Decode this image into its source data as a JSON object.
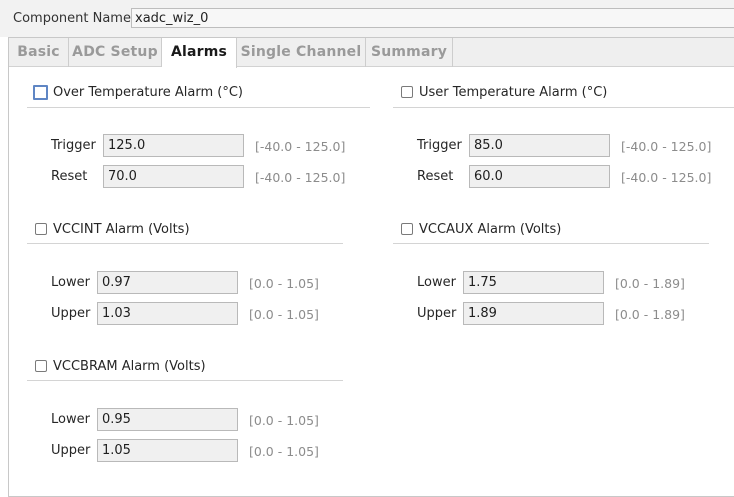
{
  "component": {
    "label": "Component Name",
    "value": "xadc_wiz_0"
  },
  "tabs": [
    {
      "label": "Basic"
    },
    {
      "label": "ADC Setup"
    },
    {
      "label": "Alarms"
    },
    {
      "label": "Single Channel"
    },
    {
      "label": "Summary"
    }
  ],
  "active_tab": "Alarms",
  "alarms": {
    "over_temp": {
      "title": "Over Temperature Alarm (°C)",
      "checked": false,
      "trigger_label": "Trigger",
      "trigger_value": "125.0",
      "trigger_range": "[-40.0 - 125.0]",
      "reset_label": "Reset",
      "reset_value": "70.0",
      "reset_range": "[-40.0 - 125.0]"
    },
    "user_temp": {
      "title": "User Temperature Alarm (°C)",
      "checked": false,
      "trigger_label": "Trigger",
      "trigger_value": "85.0",
      "trigger_range": "[-40.0 - 125.0]",
      "reset_label": "Reset",
      "reset_value": "60.0",
      "reset_range": "[-40.0 - 125.0]"
    },
    "vccint": {
      "title": "VCCINT Alarm (Volts)",
      "checked": false,
      "lower_label": "Lower",
      "lower_value": "0.97",
      "lower_range": "[0.0 - 1.05]",
      "upper_label": "Upper",
      "upper_value": "1.03",
      "upper_range": "[0.0 - 1.05]"
    },
    "vccaux": {
      "title": "VCCAUX Alarm (Volts)",
      "checked": false,
      "lower_label": "Lower",
      "lower_value": "1.75",
      "lower_range": "[0.0 - 1.89]",
      "upper_label": "Upper",
      "upper_value": "1.89",
      "upper_range": "[0.0 - 1.89]"
    },
    "vccbram": {
      "title": "VCCBRAM Alarm (Volts)",
      "checked": false,
      "lower_label": "Lower",
      "lower_value": "0.95",
      "lower_range": "[0.0 - 1.05]",
      "upper_label": "Upper",
      "upper_value": "1.05",
      "upper_range": "[0.0 - 1.05]"
    }
  },
  "colors": {
    "accent_focus": "#5f86c4",
    "range_text": "#8c8c8c",
    "field_bg": "#f0f0f0"
  }
}
